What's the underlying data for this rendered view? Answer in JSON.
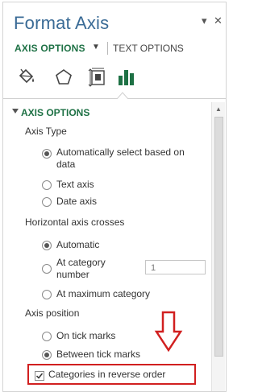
{
  "pane": {
    "title": "Format Axis",
    "dropdown_icon": "dropdown-triangle-icon",
    "close_icon": "close-icon",
    "dropdown_glyph": "▾",
    "close_glyph": "✕"
  },
  "tabs": {
    "axis_options": "AXIS OPTIONS",
    "axis_arrow": "▼",
    "text_options": "TEXT OPTIONS"
  },
  "icons": [
    "fill-line-icon",
    "effects-pentagon-icon",
    "size-properties-icon",
    "axis-options-bar-chart-icon"
  ],
  "colors": {
    "accent": "#1e7145",
    "title": "#3a6b96",
    "highlight": "#d11f1f"
  },
  "section": {
    "header": "AXIS OPTIONS",
    "axis_type": {
      "label": "Axis Type",
      "options": [
        {
          "line1": "Automatically select based on",
          "line2": "data",
          "selected": true
        },
        {
          "label": "Text axis",
          "selected": false
        },
        {
          "label": "Date axis",
          "selected": false
        }
      ]
    },
    "horizontal_crosses": {
      "label": "Horizontal axis crosses",
      "options": [
        {
          "label": "Automatic",
          "selected": true
        },
        {
          "line1": "At category",
          "line2": "number",
          "selected": false,
          "value": "1"
        },
        {
          "label": "At maximum category",
          "selected": false
        }
      ]
    },
    "axis_position": {
      "label": "Axis position",
      "options": [
        {
          "label": "On tick marks",
          "selected": false
        },
        {
          "label": "Between tick marks",
          "selected": true
        }
      ]
    },
    "reverse_order": {
      "label": "Categories in reverse order",
      "checked": true
    }
  }
}
